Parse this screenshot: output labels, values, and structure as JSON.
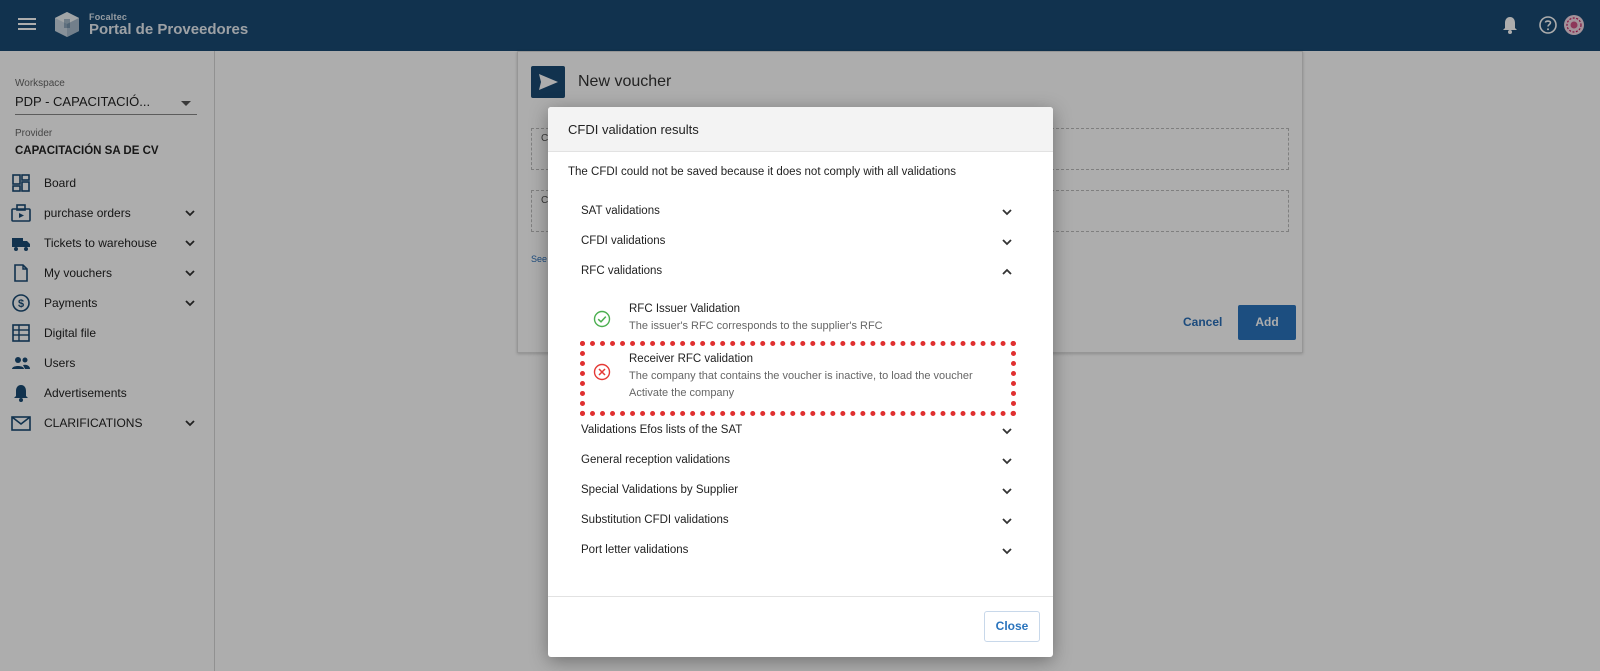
{
  "header": {
    "brand_small": "Focaltec",
    "brand_big": "Portal de Proveedores"
  },
  "sidebar": {
    "workspace_label": "Workspace",
    "workspace_value": "PDP - CAPACITACIÓ...",
    "provider_label": "Provider",
    "provider_value": "CAPACITACIÓN SA DE CV",
    "items": [
      {
        "label": "Board",
        "icon": "dashboard-icon",
        "expandable": false
      },
      {
        "label": "purchase orders",
        "icon": "purchase-orders-icon",
        "expandable": true
      },
      {
        "label": "Tickets to warehouse",
        "icon": "truck-icon",
        "expandable": true
      },
      {
        "label": "My vouchers",
        "icon": "document-icon",
        "expandable": true
      },
      {
        "label": "Payments",
        "icon": "dollar-icon",
        "expandable": true
      },
      {
        "label": "Digital file",
        "icon": "digital-file-icon",
        "expandable": false
      },
      {
        "label": "Users",
        "icon": "users-icon",
        "expandable": false
      },
      {
        "label": "Advertisements",
        "icon": "bell-icon",
        "expandable": false
      },
      {
        "label": "CLARIFICATIONS",
        "icon": "mail-icon",
        "expandable": true
      }
    ]
  },
  "main": {
    "title": "New voucher",
    "field1_label": "C",
    "field2_label": "C",
    "see_link": "See",
    "cancel_label": "Cancel",
    "add_label": "Add"
  },
  "dialog": {
    "title": "CFDI validation results",
    "message": "The CFDI could not be saved because it does not comply with all validations",
    "sections": [
      {
        "label": "SAT validations",
        "expanded": false
      },
      {
        "label": "CFDI validations",
        "expanded": false
      },
      {
        "label": "RFC validations",
        "expanded": true
      },
      {
        "label": "Validations Efos lists of the SAT",
        "expanded": false
      },
      {
        "label": "General reception validations",
        "expanded": false
      },
      {
        "label": "Special Validations by Supplier",
        "expanded": false
      },
      {
        "label": "Substitution CFDI validations",
        "expanded": false
      },
      {
        "label": "Port letter validations",
        "expanded": false
      }
    ],
    "rfc_items": [
      {
        "title": "RFC Issuer Validation",
        "desc1": "The issuer's RFC corresponds to the supplier's RFC",
        "desc2": "",
        "status": "success"
      },
      {
        "title": "Receiver RFC validation",
        "desc1": "The company that contains the voucher is inactive, to load the voucher",
        "desc2": "Activate the company",
        "status": "error"
      }
    ],
    "close_label": "Close"
  },
  "colors": {
    "topbar": "#1a4a73",
    "accent": "#2a74bd",
    "success": "#4caf50",
    "error": "#e53935",
    "highlight": "#e03030"
  }
}
